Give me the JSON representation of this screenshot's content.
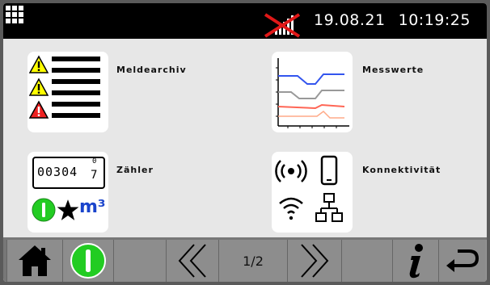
{
  "header": {
    "menu_icon": "grid-menu-icon",
    "signal_icon": "no-signal-icon",
    "date": "19.08.21",
    "time": "10:19:25"
  },
  "tiles": {
    "meldearchiv": {
      "label": "Meldearchiv",
      "icon": "warning-list-icon"
    },
    "messwerte": {
      "label": "Messwerte",
      "icon": "line-graph-icon"
    },
    "zaehler": {
      "label": "Zähler",
      "icon": "meter-counter-icon",
      "counter_value": "00304",
      "counter_last_digit": "7",
      "counter_fraction": "0",
      "unit": "m³"
    },
    "konnektivitaet": {
      "label": "Konnektivität",
      "icon": "connectivity-icon"
    }
  },
  "footer": {
    "page": "1/2",
    "buttons": [
      "home-icon",
      "power-icon",
      "chevron-double-left-icon",
      "chevron-double-right-icon",
      "info-icon",
      "return-icon"
    ]
  },
  "colors": {
    "topbar": "#000000",
    "warning_yellow": "#ffff00",
    "warning_red": "#ee2222",
    "power_green": "#22cc22",
    "unit_blue": "#1a44cc",
    "graph_blue": "#3355ee",
    "graph_red": "#ff6655"
  }
}
